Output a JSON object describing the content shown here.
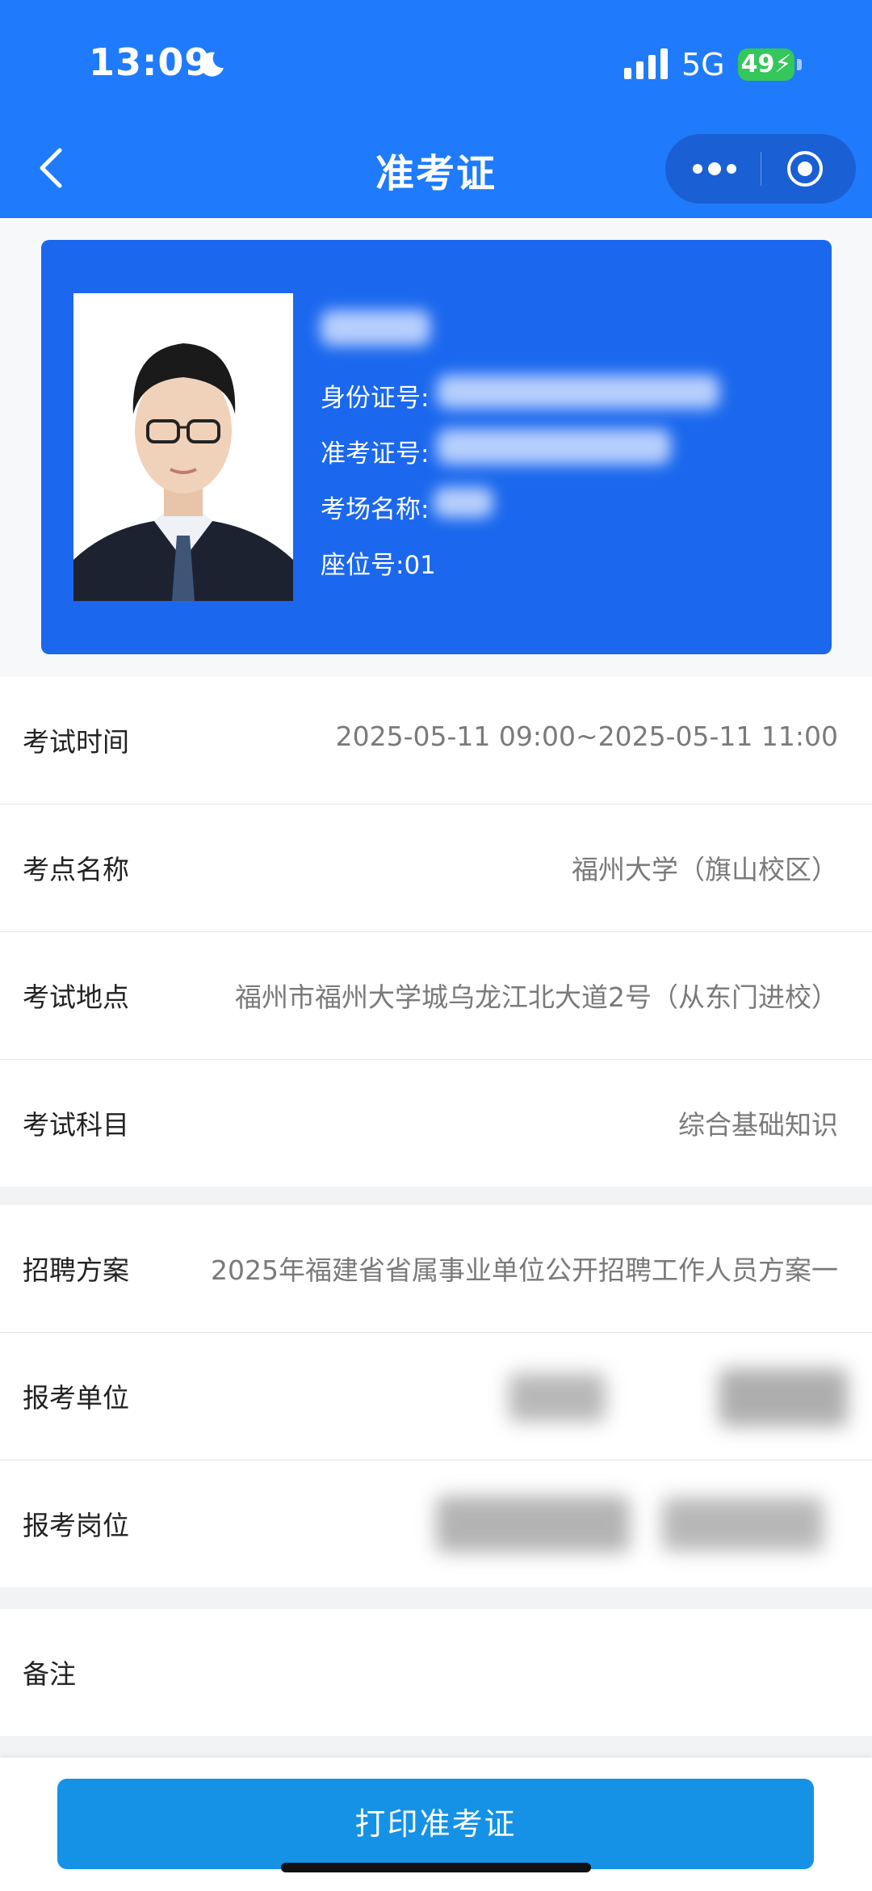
{
  "status_bar": {
    "time": "13:09",
    "network": "5G",
    "battery": "49"
  },
  "nav": {
    "title": "准考证"
  },
  "card": {
    "id_label": "身份证号:",
    "ticket_label": "准考证号:",
    "room_label": "考场名称:",
    "seat_label": "座位号:01"
  },
  "exam_info": [
    {
      "label": "考试时间",
      "value": "2025-05-11 09:00~2025-05-11 11:00"
    },
    {
      "label": "考点名称",
      "value": "福州大学（旗山校区）"
    },
    {
      "label": "考试地点",
      "value": "福州市福州大学城乌龙江北大道2号（从东门进校）"
    },
    {
      "label": "考试科目",
      "value": "综合基础知识"
    }
  ],
  "application_info": [
    {
      "label": "招聘方案",
      "value": "2025年福建省省属事业单位公开招聘工作人员方案一"
    },
    {
      "label": "报考单位",
      "value": ""
    },
    {
      "label": "报考岗位",
      "value": ""
    }
  ],
  "remark": {
    "label": "备注"
  },
  "actions": {
    "print_label": "打印准考证"
  },
  "colors": {
    "header": "#1f7bfb",
    "card": "#1b68ee",
    "button": "#1592e6",
    "battery": "#34c759"
  },
  "icons": [
    "moon-icon",
    "signal-icon",
    "back-icon",
    "more-icon",
    "target-icon"
  ]
}
